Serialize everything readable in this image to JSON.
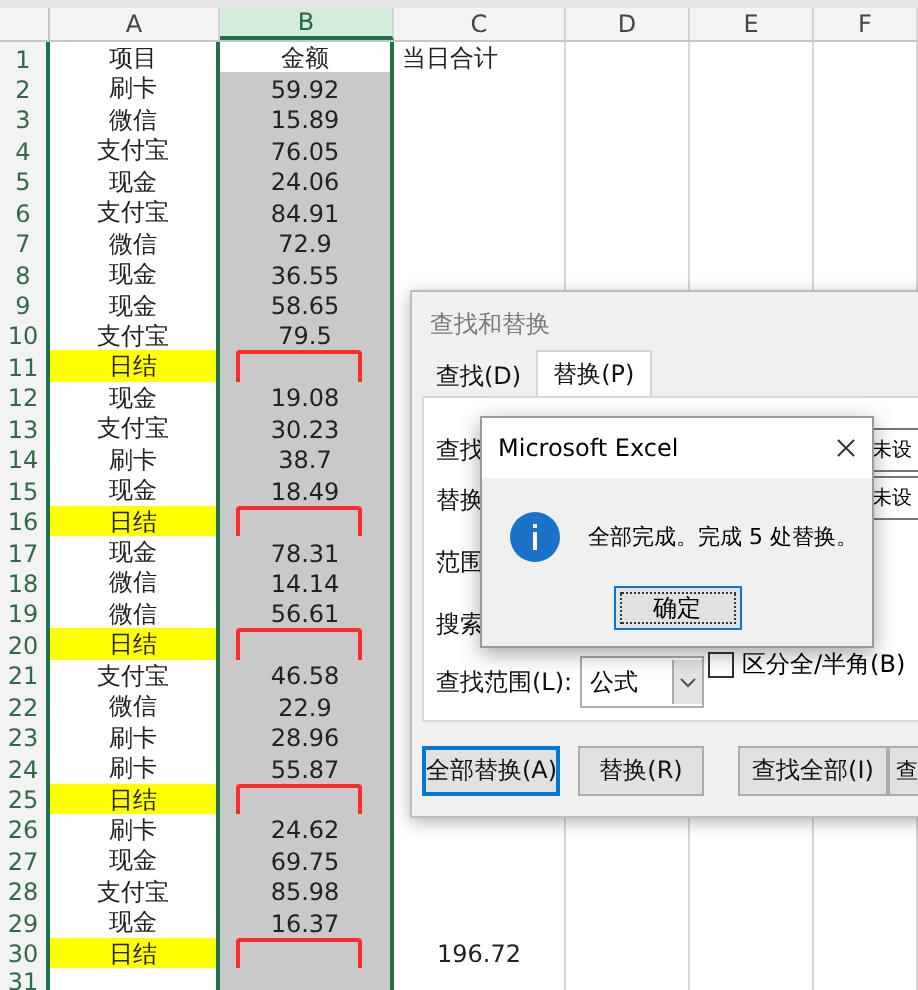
{
  "columns": [
    {
      "label": "A",
      "selected": false
    },
    {
      "label": "B",
      "selected": true
    },
    {
      "label": "C",
      "selected": false
    },
    {
      "label": "D",
      "selected": false
    },
    {
      "label": "E",
      "selected": false
    },
    {
      "label": "F",
      "selected": false
    }
  ],
  "rows": [
    {
      "number": "1",
      "kind": "heading",
      "item": "项目",
      "amount": "金额",
      "total": "当日合计"
    },
    {
      "number": "2",
      "kind": "entry",
      "item": "刷卡",
      "amount": "59.92"
    },
    {
      "number": "3",
      "kind": "entry",
      "item": "微信",
      "amount": "15.89"
    },
    {
      "number": "4",
      "kind": "entry",
      "item": "支付宝",
      "amount": "76.05"
    },
    {
      "number": "5",
      "kind": "entry",
      "item": "现金",
      "amount": "24.06"
    },
    {
      "number": "6",
      "kind": "entry",
      "item": "支付宝",
      "amount": "84.91"
    },
    {
      "number": "7",
      "kind": "entry",
      "item": "微信",
      "amount": "72.9"
    },
    {
      "number": "8",
      "kind": "entry",
      "item": "现金",
      "amount": "36.55"
    },
    {
      "number": "9",
      "kind": "entry",
      "item": "现金",
      "amount": "58.65"
    },
    {
      "number": "10",
      "kind": "entry",
      "item": "支付宝",
      "amount": "79.5"
    },
    {
      "number": "11",
      "kind": "subtotal",
      "item": "日结"
    },
    {
      "number": "12",
      "kind": "entry",
      "item": "现金",
      "amount": "19.08"
    },
    {
      "number": "13",
      "kind": "entry",
      "item": "支付宝",
      "amount": "30.23"
    },
    {
      "number": "14",
      "kind": "entry",
      "item": "刷卡",
      "amount": "38.7"
    },
    {
      "number": "15",
      "kind": "entry",
      "item": "现金",
      "amount": "18.49"
    },
    {
      "number": "16",
      "kind": "subtotal",
      "item": "日结"
    },
    {
      "number": "17",
      "kind": "entry",
      "item": "现金",
      "amount": "78.31"
    },
    {
      "number": "18",
      "kind": "entry",
      "item": "微信",
      "amount": "14.14"
    },
    {
      "number": "19",
      "kind": "entry",
      "item": "微信",
      "amount": "56.61"
    },
    {
      "number": "20",
      "kind": "subtotal",
      "item": "日结"
    },
    {
      "number": "21",
      "kind": "entry",
      "item": "支付宝",
      "amount": "46.58"
    },
    {
      "number": "22",
      "kind": "entry",
      "item": "微信",
      "amount": "22.9"
    },
    {
      "number": "23",
      "kind": "entry",
      "item": "刷卡",
      "amount": "28.96"
    },
    {
      "number": "24",
      "kind": "entry",
      "item": "刷卡",
      "amount": "55.87"
    },
    {
      "number": "25",
      "kind": "subtotal",
      "item": "日结"
    },
    {
      "number": "26",
      "kind": "entry",
      "item": "刷卡",
      "amount": "24.62"
    },
    {
      "number": "27",
      "kind": "entry",
      "item": "现金",
      "amount": "69.75"
    },
    {
      "number": "28",
      "kind": "entry",
      "item": "支付宝",
      "amount": "85.98"
    },
    {
      "number": "29",
      "kind": "entry",
      "item": "现金",
      "amount": "16.37"
    },
    {
      "number": "30",
      "kind": "subtotal",
      "item": "日结",
      "total": "196.72"
    },
    {
      "number": "31",
      "kind": "empty"
    }
  ],
  "find_replace": {
    "title": "查找和替换",
    "tabs": [
      {
        "label": "查找(D)",
        "selected": false
      },
      {
        "label": "替换(P)",
        "selected": true
      }
    ],
    "find_label": "查找",
    "replace_label": "替换",
    "format_buttons": [
      "未设",
      "未设"
    ],
    "within_label": "范围",
    "search_label": "搜索",
    "checkbox": {
      "label": "区分全/半角(B)",
      "checked": false
    },
    "look_in": {
      "label": "查找范围(L):",
      "value": "公式"
    },
    "buttons": [
      {
        "label": "全部替换(A)",
        "selected": true
      },
      {
        "label": "替换(R)",
        "selected": false
      },
      {
        "label": "查找全部(I)",
        "selected": false
      },
      {
        "label": "查",
        "selected": false
      }
    ]
  },
  "message_box": {
    "title": "Microsoft Excel",
    "message": "全部完成。完成 5 处替换。",
    "button": "确定"
  }
}
